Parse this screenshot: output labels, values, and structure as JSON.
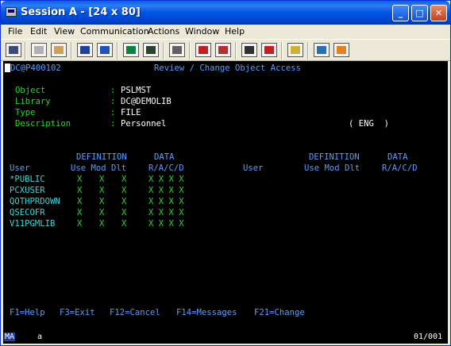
{
  "window": {
    "title": "Session A - [24 x 80]"
  },
  "menu": [
    "File",
    "Edit",
    "View",
    "Communication",
    "Actions",
    "Window",
    "Help"
  ],
  "toolbar_icons": [
    "print-screen-icon",
    "copy-icon",
    "paste-icon",
    "send-icon",
    "receive-icon",
    "display-icon",
    "keyboard-icon",
    "macro-play-icon",
    "macro-record-icon",
    "macro-run-icon",
    "macro-stop-icon",
    "clipboard-icon",
    "globe-icon",
    "help-ticket-icon"
  ],
  "screen": {
    "program_id": "DC@P400102",
    "title": "Review / Change Object Access",
    "fields": {
      "object_label": "Object",
      "object_value": "PSLMST",
      "library_label": "Library",
      "library_value": "DC@DEMOLIB",
      "type_label": "Type",
      "type_value": "FILE",
      "description_label": "Description",
      "description_value": "Personnel",
      "language": "( ENG  )"
    },
    "headers": {
      "definition": "DEFINITION",
      "data": "DATA",
      "user": "User",
      "use_mod_dlt": "Use Mod Dlt",
      "racd": "R/A/C/D"
    },
    "colon": ":",
    "rows": [
      {
        "user": "*PUBLIC",
        "use": "X",
        "mod": "X",
        "dlt": "X",
        "data": "X X X X"
      },
      {
        "user": "PCXUSER",
        "use": "X",
        "mod": "X",
        "dlt": "X",
        "data": "X X X X"
      },
      {
        "user": "QOTHPRDOWN",
        "use": "X",
        "mod": "X",
        "dlt": "X",
        "data": "X X X X"
      },
      {
        "user": "QSECOFR",
        "use": "X",
        "mod": "X",
        "dlt": "X",
        "data": "X X X X"
      },
      {
        "user": "V11PGMLIB",
        "use": "X",
        "mod": "X",
        "dlt": "X",
        "data": "X X X X"
      }
    ],
    "function_keys": [
      "F1=Help",
      "F3=Exit",
      "F12=Cancel",
      "F14=Messages",
      "F21=Change"
    ]
  },
  "status": {
    "mode": "MA",
    "indicator": "a",
    "position": "01/001"
  }
}
